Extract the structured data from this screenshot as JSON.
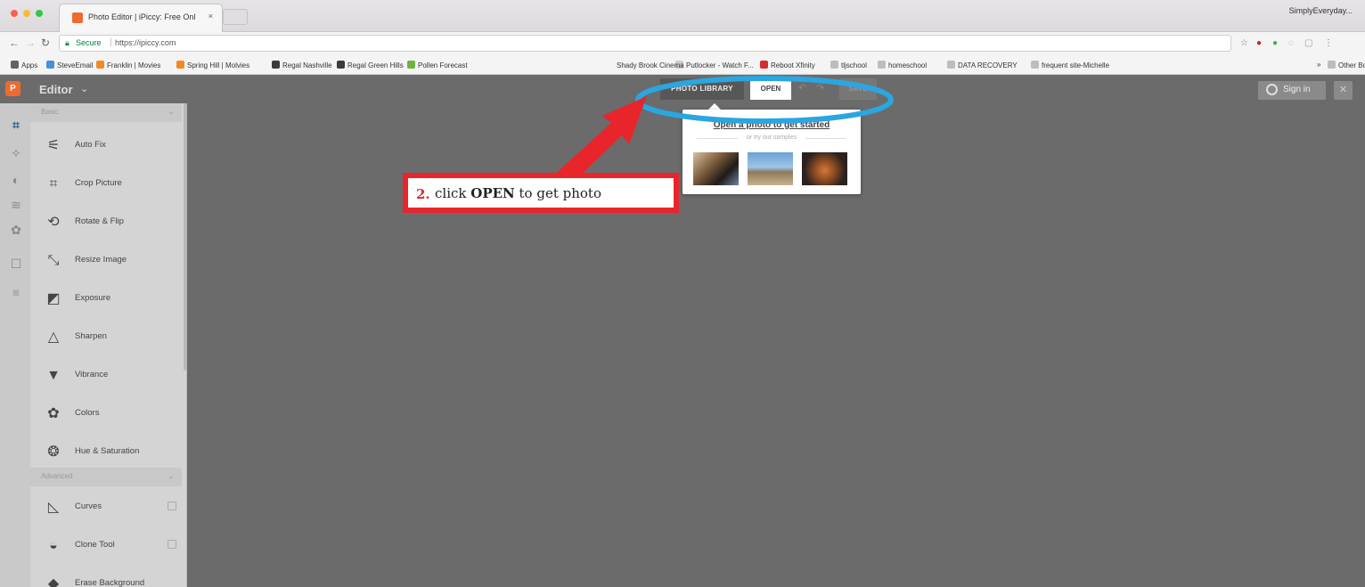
{
  "browser": {
    "tab_title": "Photo Editor | iPiccy: Free Onl",
    "tab_close": "×",
    "profile_name": "SimplyEveryday...",
    "secure_label": "Secure",
    "url": "https://ipiccy.com"
  },
  "bookmarks": [
    {
      "label": "Apps",
      "icon_color": "#5f6368"
    },
    {
      "label": "SteveEmail",
      "icon_color": "#4a90d9"
    },
    {
      "label": "Franklin | Movies",
      "icon_color": "#f08a24"
    },
    {
      "label": "Spring Hill | Molvies",
      "icon_color": "#f08a24"
    },
    {
      "label": "Regal Nashville",
      "icon_color": "#3b3b3b"
    },
    {
      "label": "Regal Green Hills",
      "icon_color": "#3b3b3b"
    },
    {
      "label": "Pollen Forecast",
      "icon_color": "#6db33f"
    },
    {
      "label": "Shady Brook Cinema",
      "icon_color": "#f4f4f4"
    },
    {
      "label": "Putlocker - Watch F...",
      "icon_color": "#cccccc"
    },
    {
      "label": "Reboot Xfinity",
      "icon_color": "#d32f2f"
    },
    {
      "label": "tljschool",
      "icon_color": "#bdbdbd"
    },
    {
      "label": "homeschool",
      "icon_color": "#bdbdbd"
    },
    {
      "label": "DATA RECOVERY",
      "icon_color": "#bdbdbd"
    },
    {
      "label": "frequent site-Michelle",
      "icon_color": "#bdbdbd"
    }
  ],
  "bookmarks_more": "»",
  "other_bookmarks": "Other Bookmarks",
  "app": {
    "logo_text": "P",
    "editor_title": "Editor",
    "editor_chevron": "⌄",
    "toolbar": {
      "photo_library": "PHOTO LIBRARY",
      "open": "OPEN",
      "undo": "↶",
      "redo": "↷",
      "save": "SAVE"
    },
    "sign_in": "Sign in",
    "close": "✕"
  },
  "panel": {
    "basic_label": "Basic",
    "advanced_label": "Advanced",
    "basic_tools": [
      {
        "label": "Auto Fix",
        "icon": "magic-wand-icon"
      },
      {
        "label": "Crop Picture",
        "icon": "crop-icon"
      },
      {
        "label": "Rotate & Flip",
        "icon": "rotate-icon"
      },
      {
        "label": "Resize Image",
        "icon": "resize-icon"
      },
      {
        "label": "Exposure",
        "icon": "exposure-icon"
      },
      {
        "label": "Sharpen",
        "icon": "sharpen-icon"
      },
      {
        "label": "Vibrance",
        "icon": "vibrance-icon"
      },
      {
        "label": "Colors",
        "icon": "colors-icon"
      },
      {
        "label": "Hue & Saturation",
        "icon": "hue-saturation-icon"
      }
    ],
    "advanced_tools": [
      {
        "label": "Curves",
        "icon": "curves-icon"
      },
      {
        "label": "Clone Tool",
        "icon": "clone-icon"
      },
      {
        "label": "Erase Background",
        "icon": "eraser-icon"
      }
    ]
  },
  "popup": {
    "title": "Open a photo to get started",
    "subtitle": "or try our samples",
    "close": "×"
  },
  "annotation": {
    "step_number": "2.",
    "text_before": "click ",
    "text_bold": "OPEN",
    "text_after": " to get photo",
    "arrow_color": "#e8252b",
    "ellipse_color": "#2aa6e0"
  }
}
